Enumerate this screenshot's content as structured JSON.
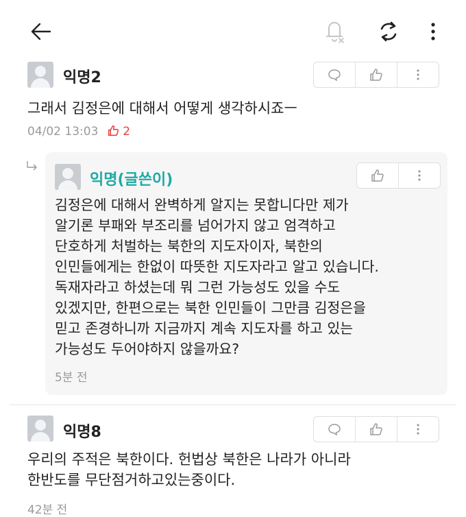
{
  "topbar": {
    "back_icon": "arrow-left-icon",
    "notification_icon": "bell-off-icon",
    "refresh_icon": "refresh-icon",
    "more_icon": "kebab-menu-icon"
  },
  "comments": [
    {
      "author": "익명2",
      "text": "그래서 김정은에 대해서 어떻게 생각하시죠ㅡ",
      "date": "04/02 13:03",
      "likes": "2"
    },
    {
      "author": "익명(글쓴이)",
      "text": "김정은에 대해서 완벽하게 알지는 못합니다만 제가\n알기론 부패와 부조리를 넘어가지 않고 엄격하고\n단호하게 처벌하는 북한의 지도자이자, 북한의\n인민들에게는 한없이 따뜻한 지도자라고 알고 있습니다.\n독재자라고 하셨는데 뭐 그런 가능성도 있을 수도\n있겠지만, 한편으로는 북한 인민들이 그만큼 김정은을\n믿고 존경하니까 지금까지 계속 지도자를 하고 있는\n가능성도 두어야하지 않을까요?",
      "date": "5분 전"
    },
    {
      "author": "익명8",
      "text": "우리의 주적은 북한이다. 헌법상 북한은 나라가 아니라\n한반도를 무단점거하고있는중이다.",
      "date": "42분 전"
    }
  ],
  "colors": {
    "accent": "#1fa9a5",
    "like": "#e5413d",
    "muted": "#9a9a9a",
    "reply_bg": "#f6f6f6"
  }
}
